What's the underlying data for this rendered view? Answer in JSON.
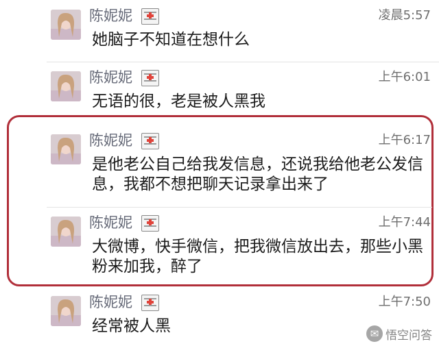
{
  "messages": [
    {
      "sender": "陈妮妮",
      "time": "凌晨5:57",
      "text": "她脑子不知道在想什么"
    },
    {
      "sender": "陈妮妮",
      "time": "上午6:01",
      "text": "无语的很，老是被人黑我"
    },
    {
      "sender": "陈妮妮",
      "time": "上午6:17",
      "text": "是他老公自己给我发信息，还说我给他老公发信息，我都不想把聊天记录拿出来了"
    },
    {
      "sender": "陈妮妮",
      "time": "上午7:44",
      "text": "大微博，快手微信，把我微信放出去，那些小黑粉来加我，醉了"
    },
    {
      "sender": "陈妮妮",
      "time": "上午7:50",
      "text": "经常被人黑"
    }
  ],
  "watermark": {
    "icon": "chat-bubble-icon",
    "text": "悟空问答"
  },
  "colors": {
    "highlight_border": "#b12f3a",
    "sender_name": "#666a78",
    "badge_cross": "#e0433a"
  }
}
